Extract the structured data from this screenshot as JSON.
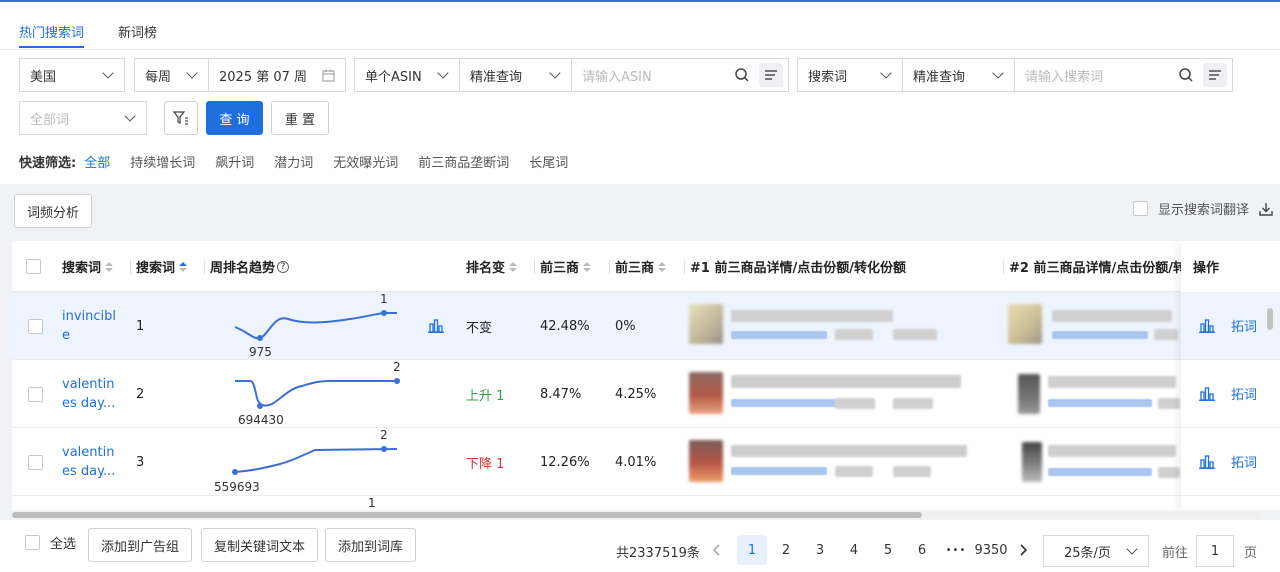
{
  "tabs": [
    {
      "label": "热门搜索词"
    },
    {
      "label": "新词榜"
    }
  ],
  "filters": {
    "country": "美国",
    "period": "每周",
    "date": "2025 第 07 周",
    "asin_mode": "单个ASIN",
    "asin_match": "精准查询",
    "asin_placeholder": "请输入ASIN",
    "term_mode": "搜索词",
    "term_match": "精准查询",
    "term_placeholder": "请输入搜索词",
    "all_terms": "全部词",
    "query": "查 询",
    "reset": "重 置"
  },
  "quick": {
    "label": "快速筛选:",
    "items": [
      "全部",
      "持续增长词",
      "飙升词",
      "潜力词",
      "无效曝光词",
      "前三商品垄断词",
      "长尾词"
    ]
  },
  "toolbar": {
    "word_freq": "词频分析",
    "show_translation": "显示搜索词翻译"
  },
  "table": {
    "headers": {
      "term": "搜索词",
      "rank": "搜索词",
      "trend": "周排名趋势",
      "change": "排名变",
      "top3_a": "前三商",
      "top3_b": "前三商",
      "top1": "#1 前三商品详情/点击份额/转化份额",
      "top2": "#2 前三商品详情/点击份额/转",
      "ops": "操作"
    },
    "rows": [
      {
        "term": "invincible",
        "rank": "1",
        "low": "975",
        "high": "1",
        "change": "不变",
        "click": "42.48%",
        "conv": "0%",
        "action": "拓词"
      },
      {
        "term": "valentines day...",
        "rank": "2",
        "low": "694430",
        "high": "2",
        "change": "上升 1",
        "click": "8.47%",
        "conv": "4.25%",
        "action": "拓词"
      },
      {
        "term": "valentines day...",
        "rank": "3",
        "low": "559693",
        "high": "2",
        "change": "下降 1",
        "click": "12.26%",
        "conv": "4.01%",
        "action": "拓词"
      }
    ],
    "next_row_high": "1"
  },
  "footer": {
    "select_all": "全选",
    "add_to_group": "添加到广告组",
    "copy_keywords": "复制关键词文本",
    "add_to_library": "添加到词库",
    "total": "共2337519条",
    "pages": [
      "1",
      "2",
      "3",
      "4",
      "5",
      "6"
    ],
    "ellipsis": "•••",
    "last_page": "9350",
    "page_size": "25条/页",
    "goto_label": "前往",
    "goto_value": "1",
    "page_unit": "页"
  },
  "colors": {
    "accent": "#1e6fdc",
    "up": "#2f9e44",
    "down": "#e03131",
    "spark": "#3b6fd6"
  }
}
